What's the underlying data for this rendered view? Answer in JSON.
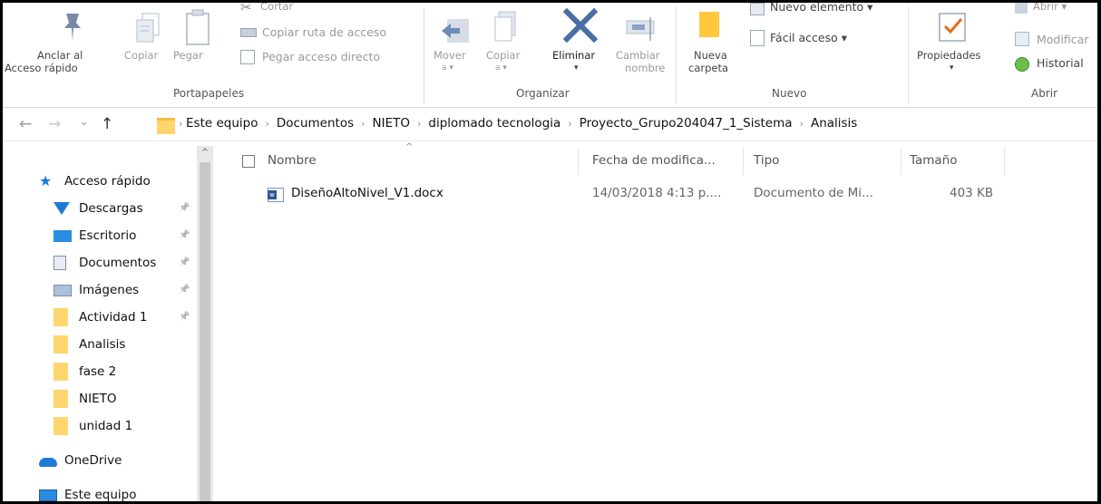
{
  "ribbon": {
    "clipboard": {
      "pin_label_1": "Anclar al",
      "pin_label_2": "Acceso rápido",
      "copy_label": "Copiar",
      "paste_label": "Pegar",
      "cut_label": "Cortar",
      "copy_path_label": "Copiar ruta de acceso",
      "paste_shortcut_label": "Pegar acceso directo",
      "group_label": "Portapapeles"
    },
    "organize": {
      "move_label_1": "Mover",
      "move_label_2": "a ▾",
      "copyto_label_1": "Copiar",
      "copyto_label_2": "a ▾",
      "delete_label": "Eliminar",
      "delete_arrow": "▾",
      "rename_label_1": "Cambiar",
      "rename_label_2": "nombre",
      "group_label": "Organizar"
    },
    "new": {
      "newfolder_label_1": "Nueva",
      "newfolder_label_2": "carpeta",
      "newitem_label": "Nuevo elemento ▾",
      "easyaccess_label": "Fácil acceso ▾",
      "group_label": "Nuevo"
    },
    "open": {
      "properties_label": "Propiedades",
      "properties_arrow": "▾",
      "open_label": "Abrir ▾",
      "edit_label": "Modificar",
      "history_label": "Historial",
      "group_label": "Abrir"
    }
  },
  "nav": {
    "back": "←",
    "forward": "→",
    "recent": "⌄",
    "up": "↑"
  },
  "breadcrumb": [
    "Este equipo",
    "Documentos",
    "NIETO",
    "diplomado tecnologia",
    "Proyecto_Grupo204047_1_Sistema",
    "Analisis"
  ],
  "breadcrumb_sep": "›",
  "sidebar": {
    "quick_access": "Acceso rápido",
    "items": [
      {
        "label": "Descargas",
        "pinned": true
      },
      {
        "label": "Escritorio",
        "pinned": true
      },
      {
        "label": "Documentos",
        "pinned": true
      },
      {
        "label": "Imágenes",
        "pinned": true
      },
      {
        "label": "Actividad 1",
        "pinned": true
      },
      {
        "label": "Analisis",
        "pinned": false
      },
      {
        "label": "fase 2",
        "pinned": false
      },
      {
        "label": "NIETO",
        "pinned": false
      },
      {
        "label": "unidad 1",
        "pinned": false
      }
    ],
    "onedrive": "OneDrive",
    "this_pc": "Este equipo",
    "pin_glyph": "📌"
  },
  "table": {
    "columns": {
      "name": "Nombre",
      "modified": "Fecha de modifica...",
      "type": "Tipo",
      "size": "Tamaño"
    },
    "rows": [
      {
        "name": "DiseñoAltoNivel_V1.docx",
        "modified": "14/03/2018 4:13 p....",
        "type": "Documento de Mi...",
        "size": "403 KB"
      }
    ]
  },
  "colors": {
    "folder": "#ffd66e",
    "accent_blue": "#1e7ad6",
    "delete_blue": "#2b6cb0"
  }
}
